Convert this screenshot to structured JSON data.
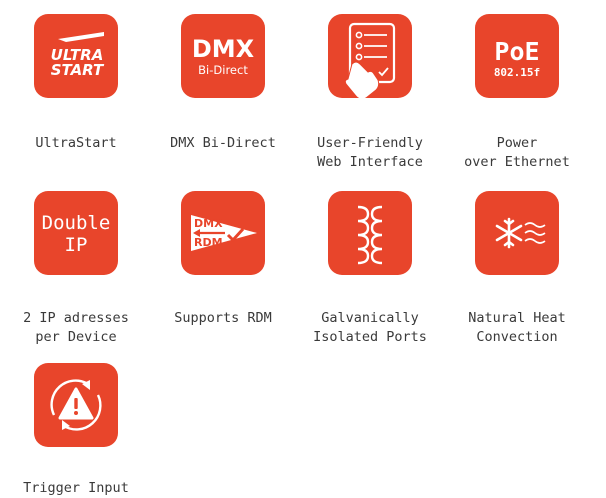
{
  "features": [
    {
      "id": "ultrastart",
      "icon": "ultra-start-icon",
      "icon_text": [
        "ULTRA",
        "START"
      ],
      "caption": [
        "UltraStart"
      ]
    },
    {
      "id": "dmx-bidirect",
      "icon": "dmx-bidirect-icon",
      "icon_text": [
        "DMX",
        "Bi-Direct"
      ],
      "caption": [
        "DMX Bi-Direct"
      ]
    },
    {
      "id": "web-interface",
      "icon": "touch-checklist-icon",
      "caption": [
        "User-Friendly",
        "Web Interface"
      ]
    },
    {
      "id": "poe",
      "icon": "poe-icon",
      "icon_text": [
        "PoE",
        "802.15f"
      ],
      "caption": [
        "Power",
        "over Ethernet"
      ]
    },
    {
      "id": "double-ip",
      "icon": "double-ip-icon",
      "icon_text": [
        "Double",
        "IP"
      ],
      "caption": [
        "2 IP adresses",
        "per Device"
      ]
    },
    {
      "id": "rdm",
      "icon": "dmx-rdm-arrow-icon",
      "icon_text": [
        "DMX",
        "RDM"
      ],
      "caption": [
        "Supports RDM"
      ]
    },
    {
      "id": "galvanic",
      "icon": "transformer-coil-icon",
      "caption": [
        "Galvanically",
        "Isolated Ports"
      ]
    },
    {
      "id": "heat",
      "icon": "snowflake-airflow-icon",
      "caption": [
        "Natural Heat",
        "Convection"
      ]
    },
    {
      "id": "trigger",
      "icon": "warning-trigger-icon",
      "caption": [
        "Trigger Input"
      ]
    }
  ],
  "colors": {
    "tile": "#e8452b",
    "icon_fg": "#ffffff",
    "caption": "#3a3a3a"
  }
}
